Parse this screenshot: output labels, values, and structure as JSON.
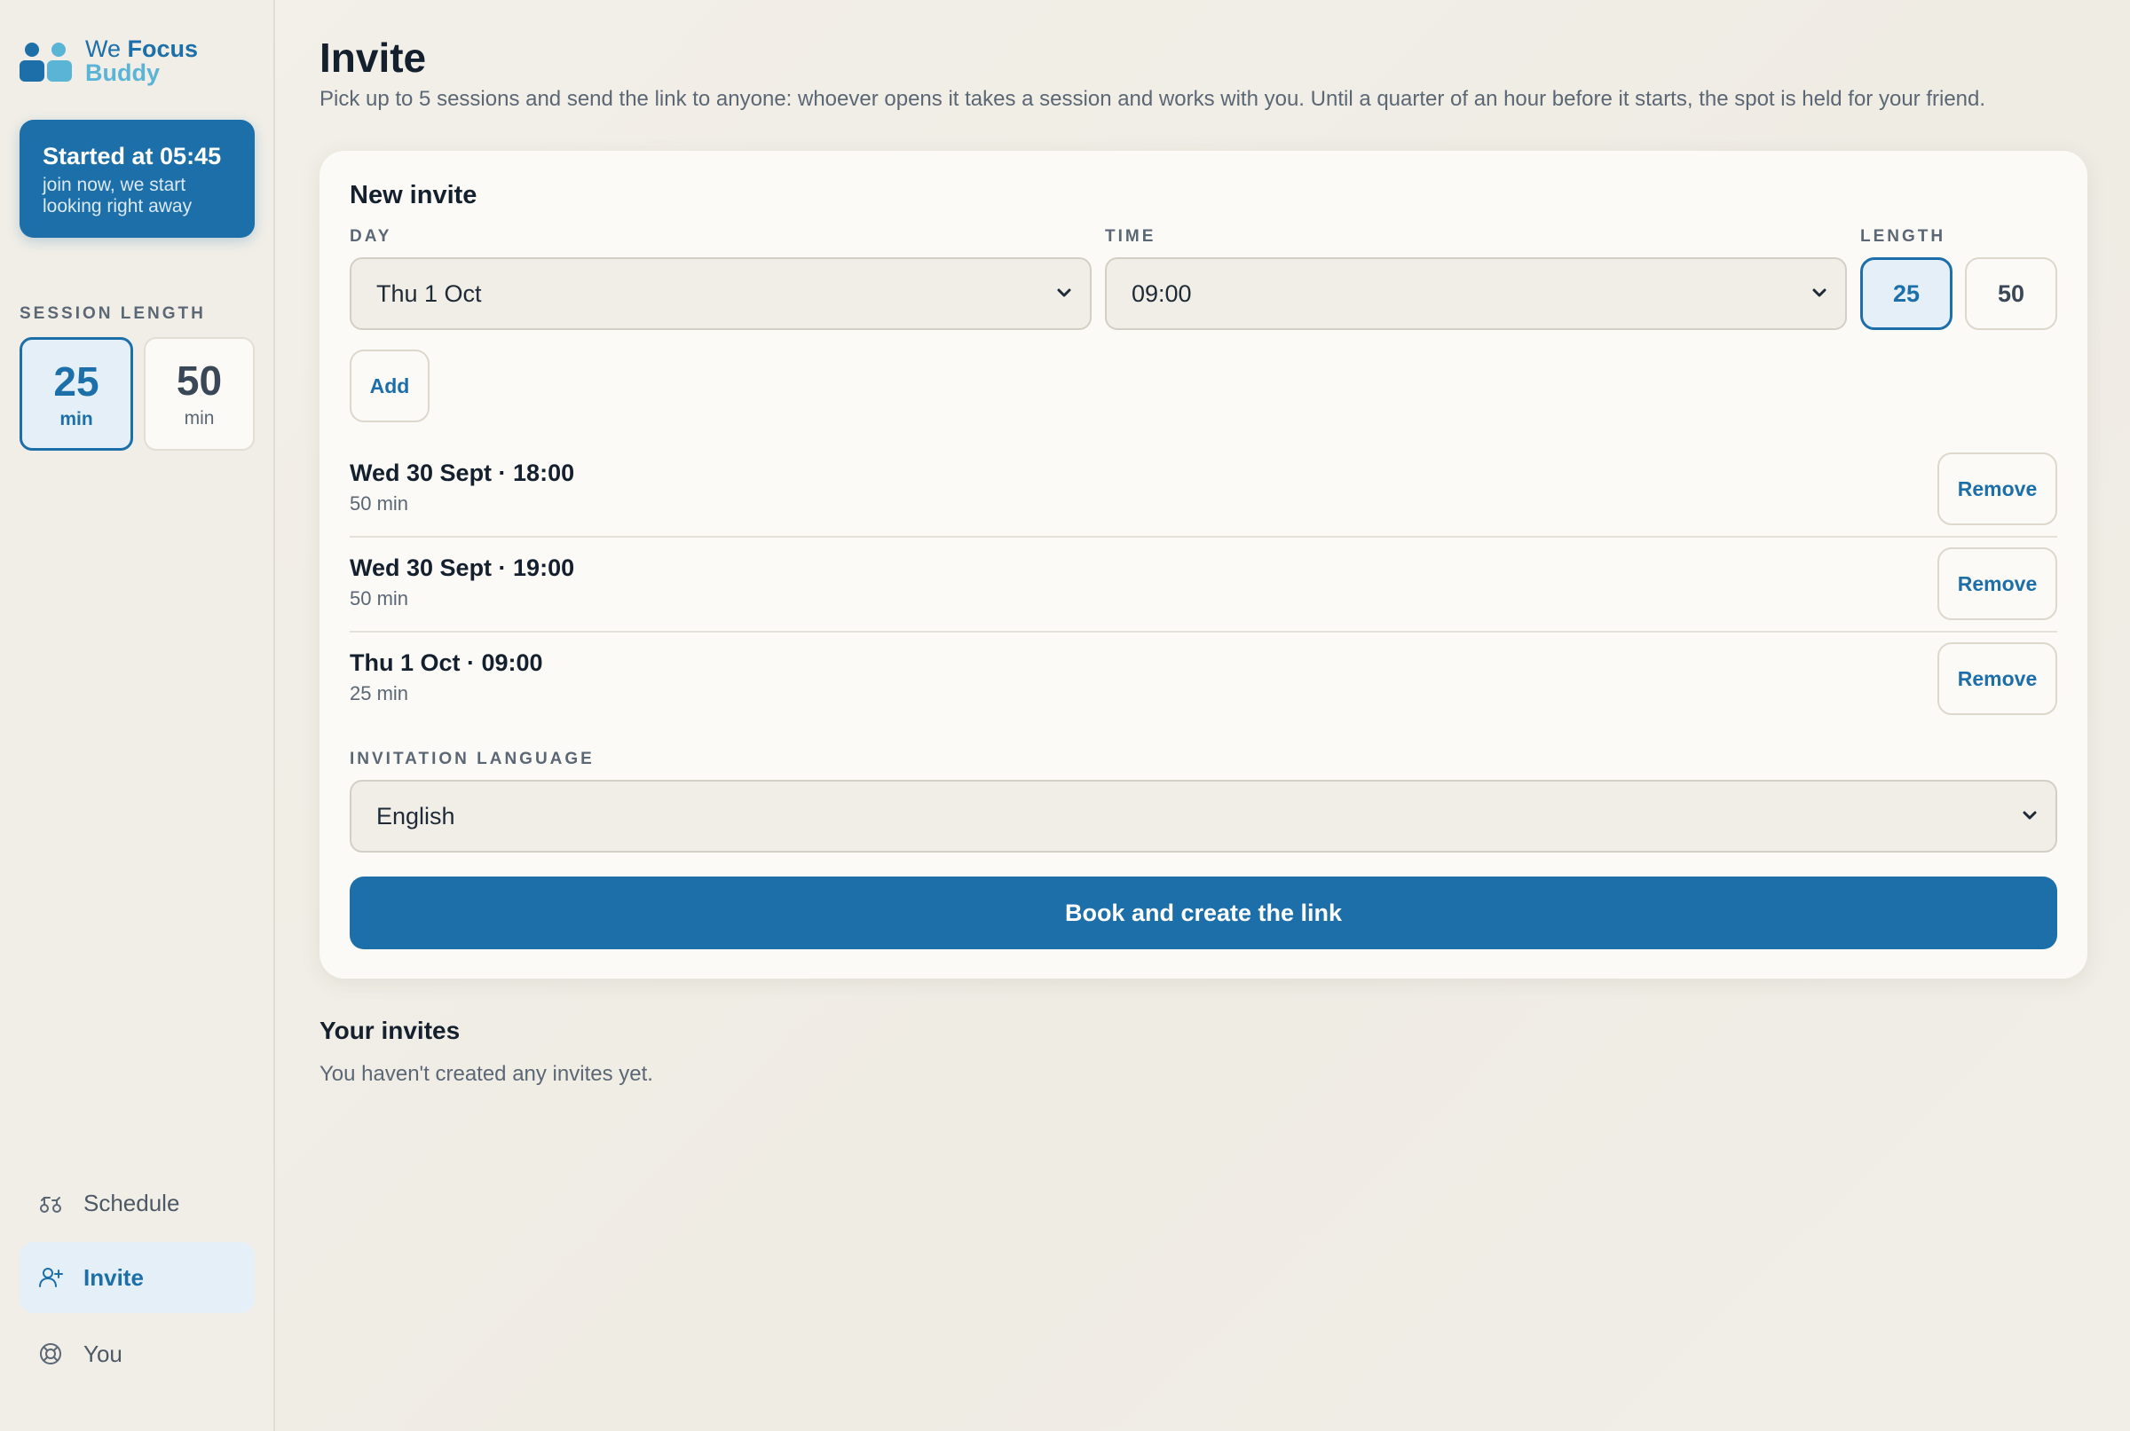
{
  "brand": {
    "we": "We",
    "focus": "Focus",
    "buddy": "Buddy"
  },
  "started": {
    "title": "Started at 05:45",
    "subtitle": "join now, we start looking right away"
  },
  "sidebar": {
    "session_length_label": "SESSION LENGTH",
    "lengths": [
      {
        "value": "25",
        "unit": "min",
        "selected": true
      },
      {
        "value": "50",
        "unit": "min",
        "selected": false
      }
    ],
    "nav": [
      {
        "label": "Schedule",
        "icon": "schedule-icon",
        "active": false
      },
      {
        "label": "Invite",
        "icon": "user-plus-icon",
        "active": true
      },
      {
        "label": "You",
        "icon": "lifebuoy-icon",
        "active": false
      }
    ]
  },
  "page": {
    "title": "Invite",
    "subtitle": "Pick up to 5 sessions and send the link to anyone: whoever opens it takes a session and works with you. Until a quarter of an hour before it starts, the spot is held for your friend."
  },
  "new_invite": {
    "title": "New invite",
    "day_label": "DAY",
    "day_value": "Thu 1 Oct",
    "time_label": "TIME",
    "time_value": "09:00",
    "length_label": "LENGTH",
    "length_options": [
      {
        "label": "25",
        "selected": true
      },
      {
        "label": "50",
        "selected": false
      }
    ],
    "add_label": "Add",
    "sessions": [
      {
        "when": "Wed 30 Sept · 18:00",
        "duration": "50 min",
        "remove_label": "Remove"
      },
      {
        "when": "Wed 30 Sept · 19:00",
        "duration": "50 min",
        "remove_label": "Remove"
      },
      {
        "when": "Thu 1 Oct · 09:00",
        "duration": "25 min",
        "remove_label": "Remove"
      }
    ],
    "language_label": "INVITATION LANGUAGE",
    "language_value": "English",
    "submit_label": "Book and create the link"
  },
  "invites": {
    "title": "Your invites",
    "empty_text": "You haven't created any invites yet."
  },
  "colors": {
    "accent": "#1c6fa8",
    "accent_light": "#5ab4d6",
    "selected_bg": "#e5eff8"
  }
}
